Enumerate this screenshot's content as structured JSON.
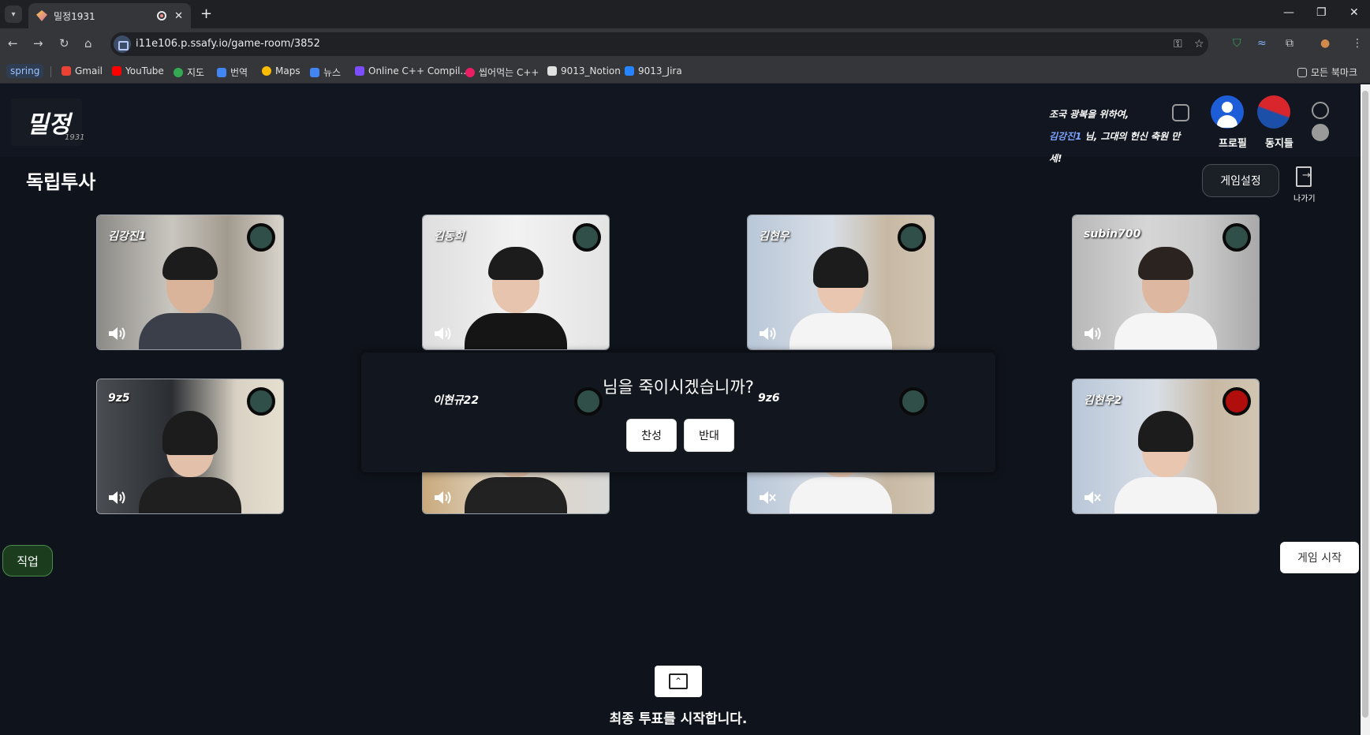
{
  "browser": {
    "tab_title": "밀정1931",
    "url": "i11e106.p.ssafy.io/game-room/3852",
    "bookmarks": [
      {
        "label": "spring"
      },
      {
        "label": "Gmail",
        "color": "#ea4335"
      },
      {
        "label": "YouTube",
        "color": "#ff0000"
      },
      {
        "label": "지도",
        "color": "#34a853"
      },
      {
        "label": "번역",
        "color": "#4285f4"
      },
      {
        "label": "Maps",
        "color": "#fbbc04"
      },
      {
        "label": "뉴스",
        "color": "#4285f4"
      },
      {
        "label": "Online C++ Compil...",
        "color": "#7c4dff"
      },
      {
        "label": "씹어먹는 C++",
        "color": "#e91e63"
      },
      {
        "label": "9013_Notion",
        "color": "#e0e0e0"
      },
      {
        "label": "9013_Jira",
        "color": "#2684ff"
      }
    ],
    "all_bookmarks": "모든 북마크"
  },
  "header": {
    "logo_main": "밀정",
    "logo_sub": "1931",
    "slogan_line1": "조국 광복을 위하여,",
    "slogan_user": "김강진1",
    "slogan_line2": " 님, 그대의 헌신 축원 만세!",
    "profile_label": "프로필",
    "comrades_label": "동지들"
  },
  "room": {
    "title": "독립투사",
    "settings_label": "게임설정",
    "exit_label": "나가기"
  },
  "players": [
    {
      "name": "김강진1",
      "muted": false,
      "status": "alive"
    },
    {
      "name": "김동희",
      "muted": false,
      "status": "alive"
    },
    {
      "name": "김현우",
      "muted": false,
      "status": "alive"
    },
    {
      "name": "subin700",
      "muted": false,
      "status": "alive"
    },
    {
      "name": "9z5",
      "muted": false,
      "status": "alive"
    },
    {
      "name": "이현규22",
      "muted": false,
      "status": "alive"
    },
    {
      "name": "9z6",
      "muted": true,
      "status": "alive"
    },
    {
      "name": "김현우2",
      "muted": true,
      "status": "targeted"
    }
  ],
  "vote_modal": {
    "question": "님을 죽이시겠습니까?",
    "agree_label": "찬성",
    "disagree_label": "반대"
  },
  "role_label": "직업",
  "start_label": "게임 시작",
  "final_vote_text": "최종 투표를 시작합니다.",
  "colors": {
    "alive": "#2f4f48",
    "targeted": "#b00d0d",
    "app_bg": "#0f131b"
  }
}
